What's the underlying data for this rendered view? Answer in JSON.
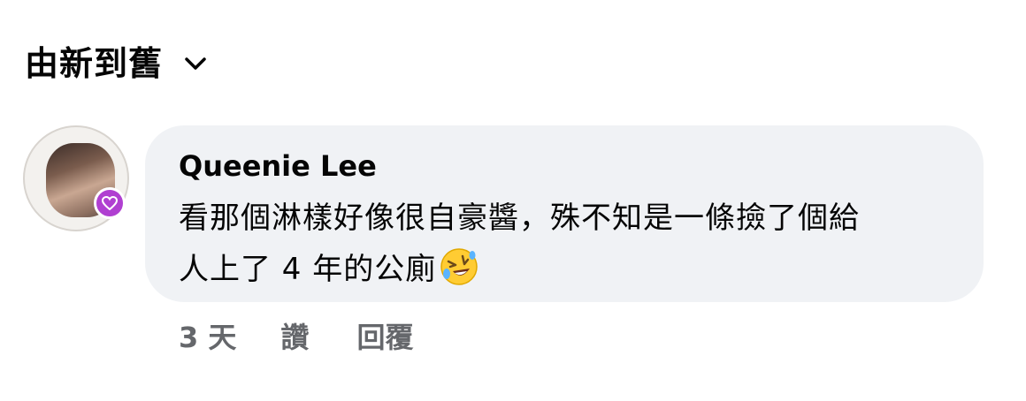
{
  "sort": {
    "label": "由新到舊",
    "icon": "chevron-down-icon"
  },
  "comment": {
    "author": "Queenie Lee",
    "text_line1": "看那個淋樣好像很自豪醬，殊不知是一條撿了個給",
    "text_line2": "人上了 4 年的公廁",
    "emoji": "rolling-on-floor-laughing-emoji",
    "avatar_icon": "profile-avatar",
    "badge_icon": "heart-badge-icon",
    "time": "3 天",
    "like_label": "讚",
    "reply_label": "回覆"
  },
  "colors": {
    "bubble_bg": "#f0f2f5",
    "meta_text": "#65676b",
    "badge": "#b03fd1"
  }
}
